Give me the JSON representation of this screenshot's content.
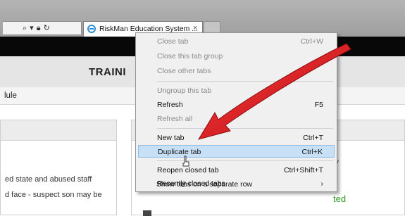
{
  "browser": {
    "tab_label": "RiskMan Education System ...",
    "tab_close": "×",
    "address_icons": [
      "search-icon",
      "dropdown-icon",
      "lock-icon",
      "refresh-icon"
    ]
  },
  "page": {
    "title": "TRAINI",
    "nav_module": "lule",
    "left_panel": {
      "line1": "ed state and abused staff",
      "line2": "d face - suspect son may be"
    },
    "right_panel": {
      "letter": "v",
      "status": "ted"
    }
  },
  "context_menu": {
    "items": [
      {
        "label": "Close tab",
        "shortcut": "Ctrl+W",
        "enabled": false
      },
      {
        "label": "Close this tab group",
        "shortcut": "",
        "enabled": false
      },
      {
        "label": "Close other tabs",
        "shortcut": "",
        "enabled": false
      },
      {
        "label": "Ungroup this tab",
        "shortcut": "",
        "enabled": false
      },
      {
        "label": "Refresh",
        "shortcut": "F5",
        "enabled": true
      },
      {
        "label": "Refresh all",
        "shortcut": "",
        "enabled": false
      },
      {
        "label": "New tab",
        "shortcut": "Ctrl+T",
        "enabled": true
      },
      {
        "label": "Duplicate tab",
        "shortcut": "Ctrl+K",
        "enabled": true,
        "highlighted": true
      },
      {
        "label": "Reopen closed tab",
        "shortcut": "Ctrl+Shift+T",
        "enabled": true
      },
      {
        "label": "Recently closed tabs",
        "shortcut": "›",
        "enabled": true
      },
      {
        "label": "Show tabs on a separate row",
        "shortcut": "",
        "enabled": true
      }
    ]
  },
  "colors": {
    "menu_highlight": "#c8e0f6",
    "annotation_arrow": "#d8141c",
    "status_green": "#2f9a25"
  }
}
